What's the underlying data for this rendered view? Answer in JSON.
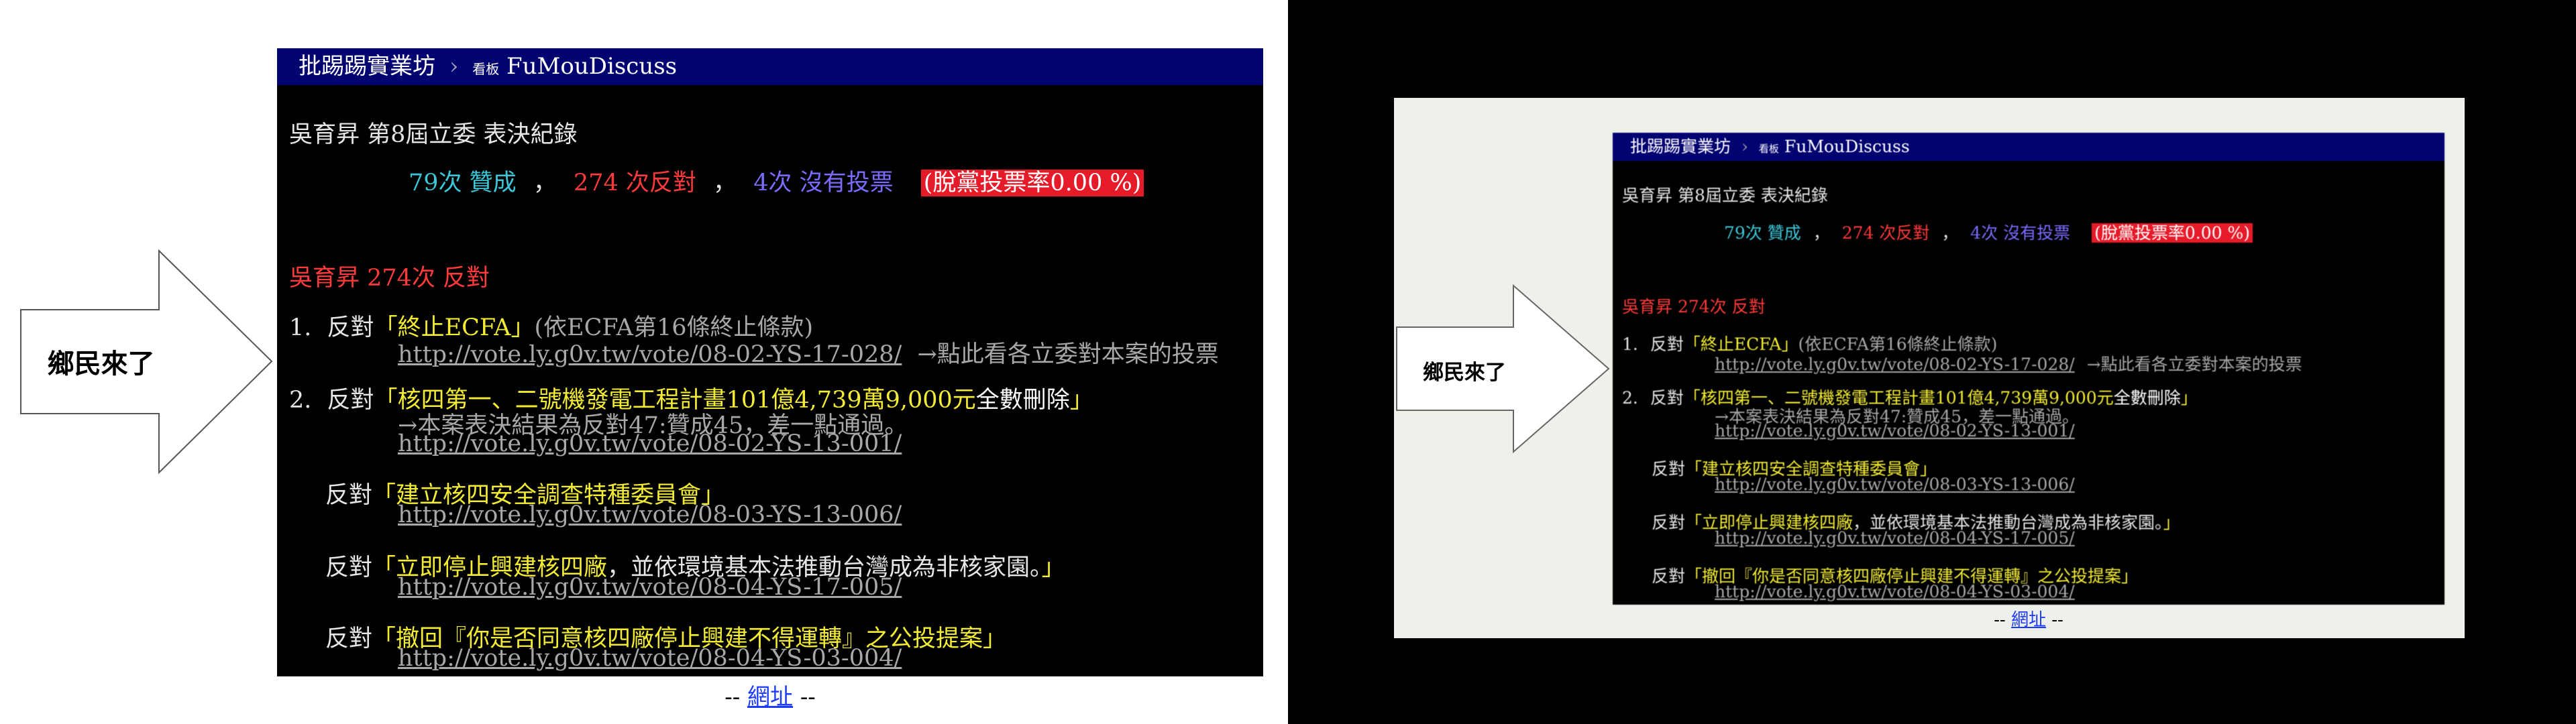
{
  "callout_text": "鄉民來了",
  "board": {
    "site_name": "批踢踢實業坊",
    "separator": "›",
    "kanban_label": "看板",
    "board_name": "FuMouDiscuss"
  },
  "record": {
    "title": "吳育昇 第8屆立委 表決紀錄",
    "summary": {
      "yes": "79次 贊成",
      "comma1": "，",
      "no": "274 次反對",
      "comma2": "，",
      "absent": "4次 沒有投票",
      "defect_rate": "(脫黨投票率0.00 %)"
    },
    "section_heading": "吳育昇 274次 反對",
    "items": [
      {
        "number": "1.",
        "vote": "反對",
        "open": "「",
        "title": "終止ECFA",
        "close": "」",
        "note": "(依ECFA第16條終止條款)",
        "link": "http://vote.ly.g0v.tw/vote/08-02-YS-17-028/",
        "link_hint": "→點此看各立委對本案的投票"
      },
      {
        "number": "2.",
        "vote": "反對",
        "open": "「",
        "title": "核四第一、二號機發電工程計畫101億4,739萬9,000元",
        "title_emph": "全數刪除",
        "close": "」",
        "result": "→本案表決結果為反對47:贊成45，差一點通過。",
        "link": "http://vote.ly.g0v.tw/vote/08-02-YS-13-001/"
      },
      {
        "vote": "反對",
        "open": "「",
        "title": "建立核四安全調查特種委員會",
        "close": "」",
        "link": "http://vote.ly.g0v.tw/vote/08-03-YS-13-006/"
      },
      {
        "vote": "反對",
        "open": "「",
        "title": "立即停止興建核四廠",
        "title_tail": "，並依環境基本法推動台灣成為非核家園。",
        "close": "」",
        "link": "http://vote.ly.g0v.tw/vote/08-04-YS-17-005/"
      },
      {
        "vote": "反對",
        "open": "「",
        "title": "撤回『你是否同意核四廠停止興建不得運轉』之公投提案",
        "close": "」",
        "link": "http://vote.ly.g0v.tw/vote/08-04-YS-03-004/"
      }
    ]
  },
  "caption": {
    "dash_left": "--",
    "link_text": "網址",
    "dash_right": "--"
  }
}
